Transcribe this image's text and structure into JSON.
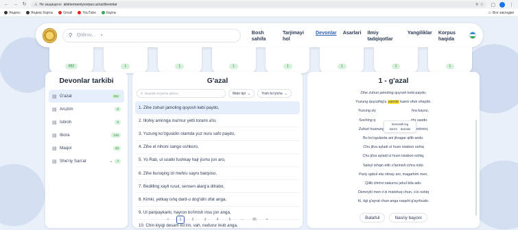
{
  "browser": {
    "security_label": "Не защищено",
    "url": "alishernavoiycorpus.uz/uz/devonlar",
    "bookmarks": [
      "Яндекс",
      "Яндекс Карты",
      "Gmail",
      "YouTube",
      "Карты"
    ],
    "all_bookmarks": "Все закладки"
  },
  "header": {
    "search_placeholder": "Qidiruv...",
    "menu": [
      "Bosh sahifa",
      "Tarjimayi hol",
      "Devonlar",
      "Asarlari",
      "Ilmiy tadqiqotlar",
      "Yangiliklar",
      "Korpus haqida"
    ],
    "active_menu": "Devonlar"
  },
  "stats": [
    "852",
    "",
    "",
    "",
    "",
    "",
    "",
    "",
    ""
  ],
  "left": {
    "title": "Devonlar tarkibi",
    "items": [
      {
        "label": "G'azal",
        "count": "852",
        "active": true
      },
      {
        "label": "Aruzim",
        "count": "0"
      },
      {
        "label": "Istiroh",
        "count": "0"
      },
      {
        "label": "Ibora",
        "count": "145"
      },
      {
        "label": "Maqol",
        "count": "33"
      },
      {
        "label": "She'riy San'at",
        "count": "7",
        "chevron": true
      }
    ]
  },
  "middle": {
    "title": "G'azal",
    "search_placeholder": "Baytdan bo'yicha qidiruv",
    "filter1": "Matn tipi",
    "filter2": "Yosh bo'yicha",
    "rows": [
      "1. Zihe zuhuri jamoling quyosh kebi paydo,",
      "2. Illohiy amringa ma'mur yetti torami a'lo,",
      "3. Yuzung ko'zgusidin olamda yuz nuru safo paydo,",
      "4. Zihe el nihoni sango oshkoro,",
      "5. Yo Rab, ul soatki fushkay hajr jismu jon aro,",
      "6. Zihe buroqing izi mehru sayru barqoso,",
      "7. Bedilling xayli rusul, sensen alarg'a dilrabo,",
      "8. Kimki, yetkay ishq dard-u dog'idin ofat anga,",
      "9. Ul paripaykarki, hayron bo'lmish insu jon anga,",
      "10. Chin kiyigi desam ko'zin, vah, nedurur ikob anga,"
    ],
    "pages": [
      "<",
      "1",
      "2",
      "3",
      "4",
      "5",
      "···",
      "85",
      ">"
    ],
    "current_page": "1"
  },
  "right": {
    "title": "1 - g'azal",
    "verses": [
      [
        "Zihe zuhuri jamoling quyosh kebi paydo,"
      ],
      [
        "Yuzung quyoshig'a ",
        "zarroti",
        " kaem ofub shaydo."
      ],
      [
        "Yuzung ziy",
        "",
        "hra bayoz,"
      ],
      [
        "Sochlng q",
        "",
        "ida savdo."
      ],
      [
        "Zuhuri husnung uchun aylabon mazohirini,"
      ],
      [
        "Bu ko'zgularda ani jilvagar qilib ando."
      ],
      [
        "Chu jilva ayladi ul husn istabon oshiq"
      ],
      [
        "Chu jilva ayladi ul husn istabon oshiq,"
      ],
      [
        "Salsyl ishqin etib o'larinish ichra nido."
      ],
      [
        "Pariy qabul eta olmay ani, magarkim men,"
      ],
      [
        "Qilib chirmi nakurnu jahul bila ado."
      ],
      [
        "Demoykl men o'zi matshuq chun, o'zi oshiq"
      ],
      [
        "Ki, tigi g'ayrat chun anga naqshi g'ayrfsudo."
      ]
    ],
    "tooltip_title": "Semantik teg",
    "tooltip_items": [
      "Zarrot",
      "Zarralar"
    ],
    "btn1": "Batafsil",
    "btn2": "Nasriy bayoni"
  }
}
